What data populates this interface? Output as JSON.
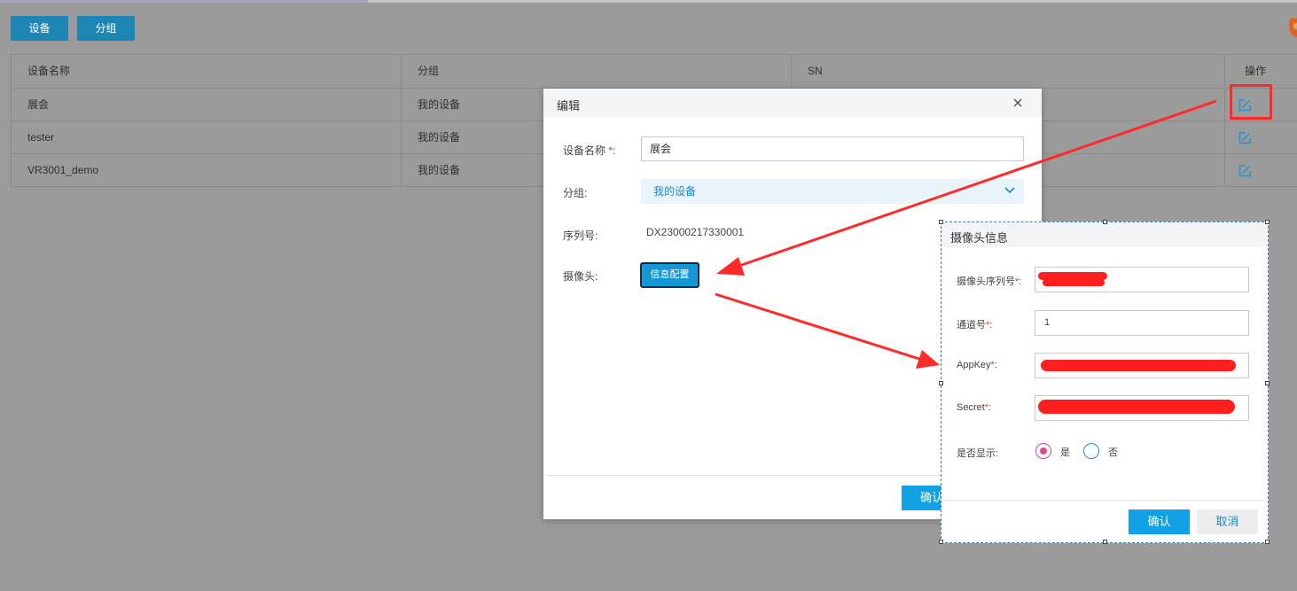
{
  "tabs": [
    {
      "label": "设备"
    },
    {
      "label": "分组"
    }
  ],
  "table": {
    "headers": [
      "设备名称",
      "分组",
      "SN",
      "操作"
    ],
    "rows": [
      {
        "name": "展会",
        "group": "我的设备"
      },
      {
        "name": "tester",
        "group": "我的设备"
      },
      {
        "name": "VR3001_demo",
        "group": "我的设备"
      }
    ]
  },
  "edit_modal": {
    "title": "编辑",
    "device_name_label": "设备名称",
    "required_mark": "*",
    "label_colon": ":",
    "device_name_value": "展会",
    "group_label": "分组:",
    "group_value": "我的设备",
    "serial_label": "序列号:",
    "serial_value": "DX23000217330001",
    "camera_label": "摄像头:",
    "camera_button": "信息配置",
    "confirm_button": "确认"
  },
  "camera_panel": {
    "title": "摄像头信息",
    "serial_label": "摄像头序列号",
    "channel_label": "通道号",
    "channel_value": "1",
    "appkey_label": "AppKey",
    "secret_label": "Secret",
    "required_mark": "*",
    "label_colon": ":",
    "display_label": "是否显示:",
    "option_yes": "是",
    "option_no": "否",
    "selected_option": "是",
    "confirm_button": "确认",
    "cancel_button": "取消"
  },
  "colors": {
    "overlay": "#9b9b9b",
    "primary_button": "#12a1e4",
    "annotation_red": "#ff2a2a",
    "radio_selected": "#e34a8a"
  },
  "icons": [
    "edit-icon",
    "close-icon",
    "chevron-down-icon",
    "brand-icon"
  ]
}
